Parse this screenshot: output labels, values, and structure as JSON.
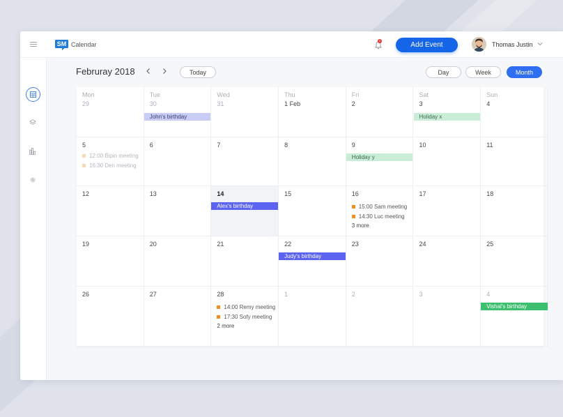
{
  "topbar": {
    "app_name": "Calendar",
    "logo_text": "SM",
    "notification_count": "2",
    "add_event_label": "Add Event",
    "user_name": "Thomas Justin"
  },
  "sidebar": {
    "items": [
      {
        "name": "calendar-icon",
        "active": true
      },
      {
        "name": "layers-icon",
        "active": false
      },
      {
        "name": "bar-chart-icon",
        "active": false
      },
      {
        "name": "gear-icon",
        "active": false
      }
    ]
  },
  "header": {
    "month_title": "Februray 2018",
    "today_label": "Today",
    "views": [
      {
        "label": "Day",
        "active": false
      },
      {
        "label": "Week",
        "active": false
      },
      {
        "label": "Month",
        "active": true
      }
    ]
  },
  "colors": {
    "accent": "#1565e8",
    "event_light_purple": "#c9cdf6",
    "event_blue": "#5b63f0",
    "event_mint": "#c9edd7",
    "event_green": "#3cbf6e",
    "dot_orange": "#f0901e",
    "dot_faded": "#f8d9b5"
  },
  "calendar": {
    "weekdays": [
      "Mon",
      "Tue",
      "Wed",
      "Thu",
      "Fri",
      "Sat",
      "Sun"
    ],
    "weeks": [
      [
        {
          "day": "29",
          "muted": true
        },
        {
          "day": "30",
          "muted": true
        },
        {
          "day": "31",
          "muted": true
        },
        {
          "day": "1 Feb"
        },
        {
          "day": "2"
        },
        {
          "day": "3"
        },
        {
          "day": "4"
        }
      ],
      [
        {
          "day": "5"
        },
        {
          "day": "6"
        },
        {
          "day": "7"
        },
        {
          "day": "8"
        },
        {
          "day": "9"
        },
        {
          "day": "10"
        },
        {
          "day": "11"
        }
      ],
      [
        {
          "day": "12"
        },
        {
          "day": "13"
        },
        {
          "day": "14",
          "today": true
        },
        {
          "day": "15"
        },
        {
          "day": "16"
        },
        {
          "day": "17"
        },
        {
          "day": "18"
        }
      ],
      [
        {
          "day": "19"
        },
        {
          "day": "20"
        },
        {
          "day": "21"
        },
        {
          "day": "22"
        },
        {
          "day": "23"
        },
        {
          "day": "24"
        },
        {
          "day": "25"
        }
      ],
      [
        {
          "day": "26"
        },
        {
          "day": "27"
        },
        {
          "day": "28"
        },
        {
          "day": "1",
          "muted": true
        },
        {
          "day": "2",
          "muted": true
        },
        {
          "day": "3",
          "muted": true
        },
        {
          "day": "4",
          "muted": true
        }
      ]
    ],
    "bars": [
      {
        "week": 0,
        "col": 1,
        "label": "John's birthday",
        "style": "light_purple"
      },
      {
        "week": 0,
        "col": 5,
        "label": "Holiday x",
        "style": "mint"
      },
      {
        "week": 1,
        "col": 4,
        "label": "Holiday y",
        "style": "mint"
      },
      {
        "week": 2,
        "col": 2,
        "label": "Alex's birthday",
        "style": "blue"
      },
      {
        "week": 3,
        "col": 3,
        "label": "Judy's birthday",
        "style": "blue"
      },
      {
        "week": 4,
        "col": 6,
        "label": "Vishal's birthday",
        "style": "green"
      }
    ],
    "meetings": [
      {
        "week": 1,
        "col": 0,
        "faded": true,
        "items": [
          "12:00 Bipin meeting",
          "16:30 Den meeting"
        ]
      },
      {
        "week": 2,
        "col": 4,
        "faded": false,
        "items": [
          "15:00 Sam meeting",
          "14:30 Luc meeting"
        ],
        "more": "3 more"
      },
      {
        "week": 4,
        "col": 2,
        "faded": false,
        "items": [
          "14:00 Remy meeting",
          "17:30 Sofy meeting"
        ],
        "more": "2 more"
      }
    ]
  }
}
